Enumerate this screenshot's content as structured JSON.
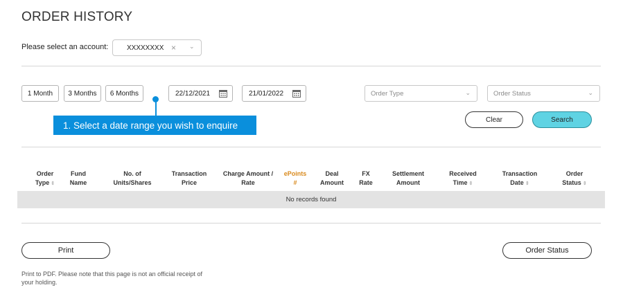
{
  "page": {
    "title": "ORDER HISTORY"
  },
  "account": {
    "label": "Please select an account:",
    "value": "XXXXXXXX",
    "clear_glyph": "×",
    "chevron_glyph": "⌄"
  },
  "periods": [
    "1 Month",
    "3 Months",
    "6 Months"
  ],
  "dates": {
    "from": "22/12/2021",
    "to": "21/01/2022"
  },
  "filters": {
    "order_type_placeholder": "Order Type",
    "order_status_placeholder": "Order Status",
    "chevron_glyph": "⌄"
  },
  "tooltip": {
    "text": "1.  Select a date range you wish to enquire"
  },
  "actions": {
    "clear": "Clear",
    "search": "Search"
  },
  "table": {
    "columns": [
      {
        "line1": "Order",
        "line2": "Type",
        "sortable": true
      },
      {
        "line1": "Fund",
        "line2": "Name",
        "sortable": false
      },
      {
        "line1": "No. of",
        "line2": "Units/Shares",
        "sortable": false
      },
      {
        "line1": "Transaction",
        "line2": "Price",
        "sortable": false
      },
      {
        "line1": "Charge Amount /",
        "line2": "Rate",
        "sortable": false
      },
      {
        "line1": "ePoints",
        "line2": "#",
        "sortable": false
      },
      {
        "line1": "Deal",
        "line2": "Amount",
        "sortable": false
      },
      {
        "line1": "FX",
        "line2": "Rate",
        "sortable": false
      },
      {
        "line1": "Settlement",
        "line2": "Amount",
        "sortable": false
      },
      {
        "line1": "Received",
        "line2": "Time",
        "sortable": true
      },
      {
        "line1": "Transaction",
        "line2": "Date",
        "sortable": true
      },
      {
        "line1": "Order",
        "line2": "Status",
        "sortable": true
      }
    ],
    "sort_glyph": "⇕",
    "empty_message": "No records found"
  },
  "footer": {
    "print": "Print",
    "order_status": "Order Status",
    "note": "Print to PDF. Please note that this page is not an official receipt of your holding."
  },
  "colors": {
    "accent": "#0a8fdc",
    "search_bg": "#5fd3e3",
    "epoints": "#d98a1d"
  }
}
